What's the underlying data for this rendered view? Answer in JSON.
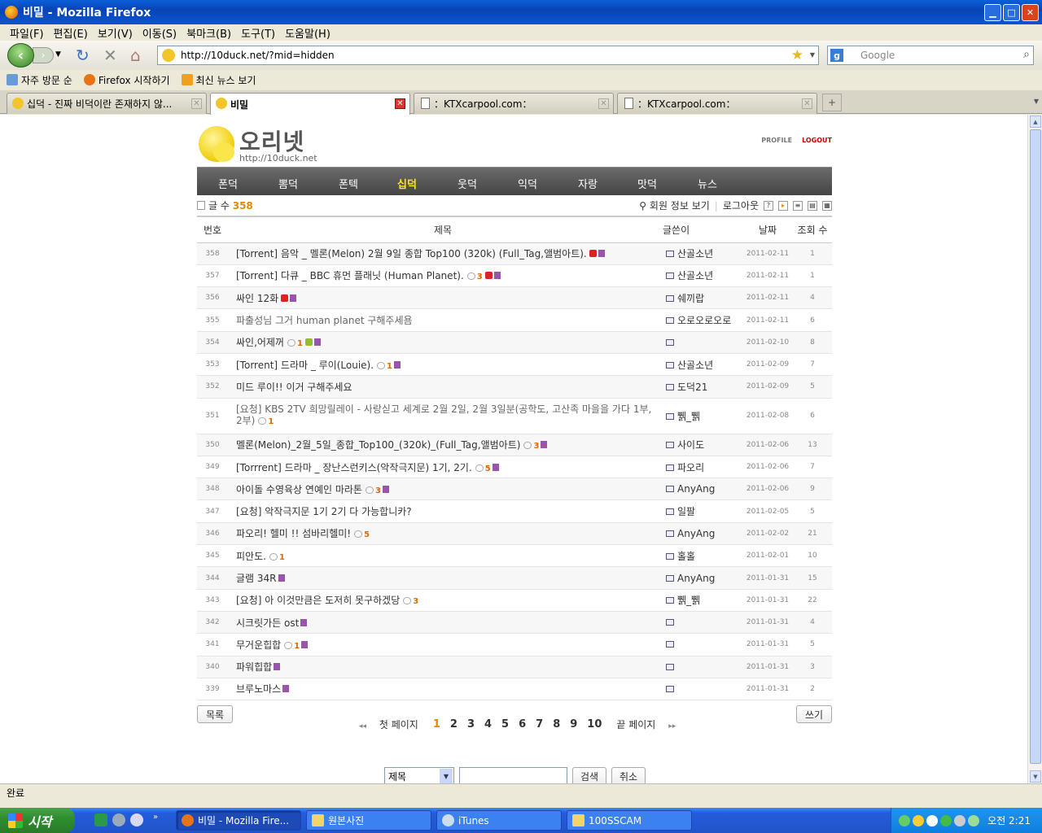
{
  "window": {
    "title": "비밀 - Mozilla Firefox"
  },
  "menu": [
    "파일(F)",
    "편집(E)",
    "보기(V)",
    "이동(S)",
    "북마크(B)",
    "도구(T)",
    "도움말(H)"
  ],
  "nav": {
    "url": "http://10duck.net/?mid=hidden",
    "search_placeholder": "Google"
  },
  "bookmarks": [
    "자주 방문 순",
    "Firefox 시작하기",
    "최신 뉴스 보기"
  ],
  "tabs": [
    "십덕 - 진짜 비덕이란 존재하지 않...",
    "비밀",
    "：KTXcarpool.com：",
    "：KTXcarpool.com："
  ],
  "site": {
    "name": "오리넷",
    "url": "http://10duck.net",
    "profile": "PROFILE",
    "logout": "LOGOUT",
    "gnb": [
      "폰덕",
      "뽐덕",
      "폰텍",
      "십덕",
      "웃덕",
      "익덕",
      "자랑",
      "맛덕",
      "뉴스"
    ],
    "post_count_label": "글 수",
    "post_count": "358",
    "member_info": "회원 정보 보기",
    "logout_kr": "로그아웃"
  },
  "table": {
    "headers": [
      "번호",
      "제목",
      "글쓴이",
      "날짜",
      "조회 수"
    ],
    "rows": [
      {
        "no": "358",
        "subject": "[Torrent] 음악 _ 멜론(Melon) 2월 9일 종합 Top100 (320k) (Full_Tag,앨범아트).",
        "comments": "",
        "new": true,
        "file": true,
        "author": "산골소년",
        "date": "2011-02-11",
        "hits": "1"
      },
      {
        "no": "357",
        "subject": "[Torrent] 다큐 _ BBC 휴먼 플래닛 (Human Planet).",
        "comments": "3",
        "new": true,
        "file": true,
        "author": "산골소년",
        "date": "2011-02-11",
        "hits": "1"
      },
      {
        "no": "356",
        "subject": "싸인 12화",
        "comments": "",
        "new": true,
        "file": true,
        "author": "쉐끼랍",
        "date": "2011-02-11",
        "hits": "4"
      },
      {
        "no": "355",
        "subject": "파출성님 그거 human planet 구해주세욤",
        "comments": "",
        "new": false,
        "file": false,
        "author": "오로오로오로",
        "date": "2011-02-11",
        "hits": "6",
        "dim": true
      },
      {
        "no": "354",
        "subject": "싸인,어제꺼",
        "comments": "1",
        "new": false,
        "upd": true,
        "file": true,
        "author": "",
        "date": "2011-02-10",
        "hits": "8"
      },
      {
        "no": "353",
        "subject": "[Torrent] 드라마 _ 루이(Louie).",
        "comments": "1",
        "new": false,
        "file": true,
        "author": "산골소년",
        "date": "2011-02-09",
        "hits": "7"
      },
      {
        "no": "352",
        "subject": "미드 루이!! 이거 구해주세요",
        "comments": "",
        "new": false,
        "file": false,
        "author": "도덕21",
        "date": "2011-02-09",
        "hits": "5"
      },
      {
        "no": "351",
        "subject": "[요청] KBS 2TV 희망릴레이 - 사랑싣고 세계로 2월 2일, 2월 3일분(공학도, 고산족 마을을 가다 1부, 2부)",
        "comments": "1",
        "new": false,
        "file": false,
        "author": "쀍_쀍",
        "date": "2011-02-08",
        "hits": "6",
        "wrap": true
      },
      {
        "no": "350",
        "subject": "멜론(Melon)_2월_5일_종합_Top100_(320k)_(Full_Tag,앨범아트)",
        "comments": "3",
        "new": false,
        "file": true,
        "author": "사이도",
        "date": "2011-02-06",
        "hits": "13"
      },
      {
        "no": "349",
        "subject": "[Torrrent] 드라마 _ 장난스런키스(악작극지문) 1기, 2기.",
        "comments": "5",
        "new": false,
        "file": true,
        "author": "파오리",
        "date": "2011-02-06",
        "hits": "7"
      },
      {
        "no": "348",
        "subject": "아이돌 수영육상 연예인 마라톤",
        "comments": "3",
        "new": false,
        "file": true,
        "author": "AnyAng",
        "date": "2011-02-06",
        "hits": "9"
      },
      {
        "no": "347",
        "subject": "[요청] 악작극지문 1기 2기 다 가능합니카?",
        "comments": "",
        "new": false,
        "file": false,
        "author": "일팔",
        "date": "2011-02-05",
        "hits": "5"
      },
      {
        "no": "346",
        "subject": "파오리! 헬미 !! 섬바리헬미!",
        "comments": "5",
        "new": false,
        "file": false,
        "author": "AnyAng",
        "date": "2011-02-02",
        "hits": "21"
      },
      {
        "no": "345",
        "subject": "피안도.",
        "comments": "1",
        "new": false,
        "file": false,
        "author": "홀홀",
        "date": "2011-02-01",
        "hits": "10"
      },
      {
        "no": "344",
        "subject": "글램 34R",
        "comments": "",
        "new": false,
        "file": true,
        "author": "AnyAng",
        "date": "2011-01-31",
        "hits": "15"
      },
      {
        "no": "343",
        "subject": "[요청] 아 이것만큼은 도저히 못구하겠당",
        "comments": "3",
        "new": false,
        "file": false,
        "author": "쀍_쀍",
        "date": "2011-01-31",
        "hits": "22"
      },
      {
        "no": "342",
        "subject": "시크릿가든 ost",
        "comments": "",
        "new": false,
        "file": true,
        "author": "",
        "date": "2011-01-31",
        "hits": "4"
      },
      {
        "no": "341",
        "subject": "무거운힙합",
        "comments": "1",
        "new": false,
        "file": true,
        "author": "",
        "date": "2011-01-31",
        "hits": "5"
      },
      {
        "no": "340",
        "subject": "파워힙합",
        "comments": "",
        "new": false,
        "file": true,
        "author": "",
        "date": "2011-01-31",
        "hits": "3"
      },
      {
        "no": "339",
        "subject": "브루노마스",
        "comments": "",
        "new": false,
        "file": true,
        "author": "",
        "date": "2011-01-31",
        "hits": "2"
      }
    ]
  },
  "buttons": {
    "list": "목록",
    "write": "쓰기",
    "search": "검색",
    "cancel": "취소"
  },
  "pager": {
    "first": "첫 페이지",
    "last": "끝 페이지",
    "pages": [
      "1",
      "2",
      "3",
      "4",
      "5",
      "6",
      "7",
      "8",
      "9",
      "10"
    ],
    "current": "1"
  },
  "search_field": {
    "selected": "제목"
  },
  "status": "완료",
  "taskbar": {
    "start": "시작",
    "items": [
      "비밀 - Mozilla Fire...",
      "원본사진",
      "iTunes",
      "100SSCAM"
    ],
    "clock": "오전 2:21"
  }
}
